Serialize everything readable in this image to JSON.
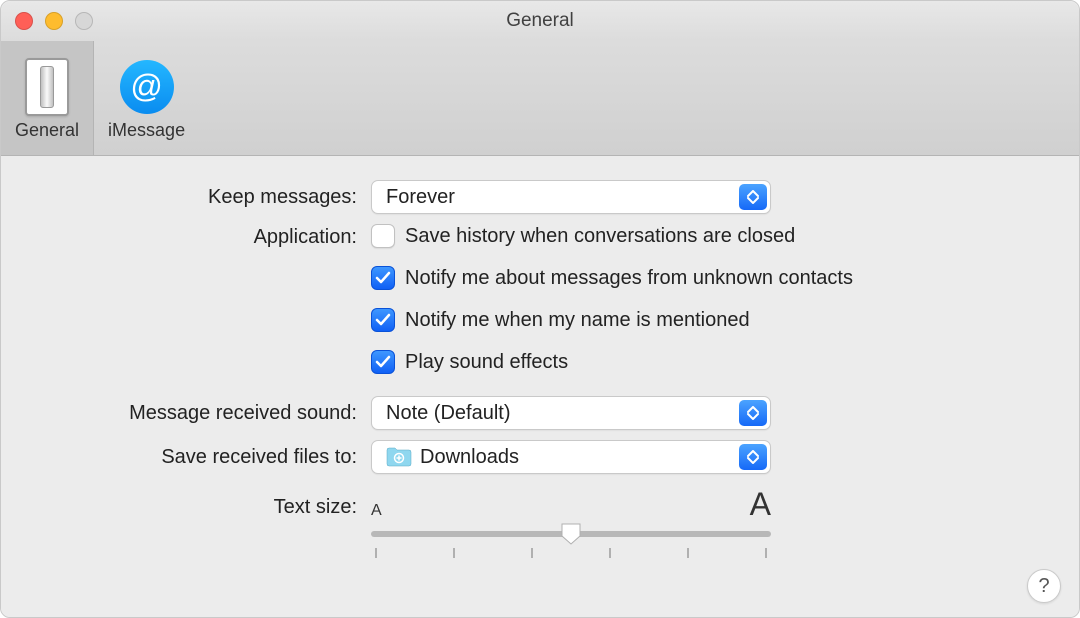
{
  "window": {
    "title": "General"
  },
  "toolbar": {
    "general": {
      "label": "General"
    },
    "imessage": {
      "label": "iMessage"
    }
  },
  "settings": {
    "keep_messages": {
      "label": "Keep messages:",
      "value": "Forever"
    },
    "application": {
      "label": "Application:",
      "save_history": {
        "label": "Save history when conversations are closed",
        "checked": false
      },
      "notify_unknown": {
        "label": "Notify me about messages from unknown contacts",
        "checked": true
      },
      "notify_mention": {
        "label": "Notify me when my name is mentioned",
        "checked": true
      },
      "play_sound": {
        "label": "Play sound effects",
        "checked": true
      }
    },
    "received_sound": {
      "label": "Message received sound:",
      "value": "Note (Default)"
    },
    "save_files_to": {
      "label": "Save received files to:",
      "value": "Downloads"
    },
    "text_size": {
      "label": "Text size:",
      "small": "A",
      "large": "A",
      "position_pct": 50,
      "ticks": 6
    }
  },
  "help": {
    "label": "?"
  }
}
